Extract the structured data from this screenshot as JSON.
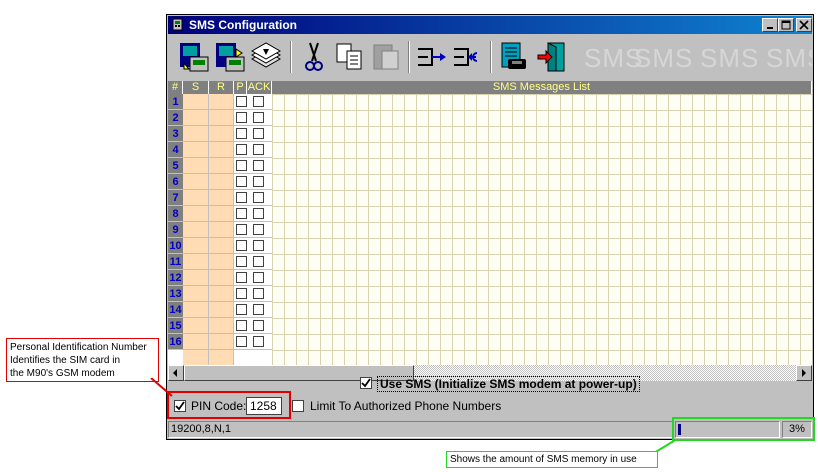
{
  "window": {
    "title": "SMS Configuration"
  },
  "toolbar": {
    "icons": [
      "load-from-modem-icon",
      "save-to-modem-icon",
      "stack-icon",
      "cut-icon",
      "copy-icon",
      "paste-icon",
      "insert-row-icon",
      "delete-row-icon",
      "phone-book-icon",
      "exit-icon"
    ],
    "watermark": [
      "SMS",
      "SMS",
      "SMS",
      "SMS",
      "SM"
    ]
  },
  "grid": {
    "headers": {
      "num": "#",
      "s": "S",
      "r": "R",
      "p": "P",
      "ack": "ACK",
      "messages": "SMS Messages List"
    },
    "rows": [
      "1",
      "2",
      "3",
      "4",
      "5",
      "6",
      "7",
      "8",
      "9",
      "10",
      "11",
      "12",
      "13",
      "14",
      "15",
      "16"
    ]
  },
  "options": {
    "use_sms_label": "Use SMS (Initialize SMS modem at power-up)",
    "use_sms_checked": true,
    "pin_label": "PIN Code:",
    "pin_checked": true,
    "pin_value": "1258",
    "limit_label": "Limit To Authorized Phone Numbers",
    "limit_checked": false
  },
  "status": {
    "comm": "19200,8,N,1",
    "memory_percent": "3%",
    "memory_fraction": 0.03
  },
  "callouts": {
    "pin_note": [
      "Personal Identification Number",
      "Identifies the SIM card in",
      "the M90's GSM modem"
    ],
    "memory_note": "Shows the amount of SMS memory in use"
  },
  "colors": {
    "title_start": "#00007b",
    "title_end": "#1084d0",
    "peach": "#ffdcb4",
    "red_callout": "#e00000",
    "green_callout": "#22d822"
  }
}
